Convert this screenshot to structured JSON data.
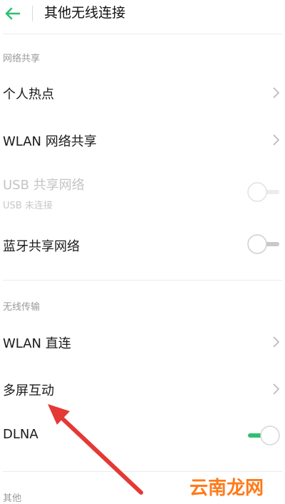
{
  "header": {
    "title": "其他无线连接",
    "back_icon": "arrow-left-icon",
    "accent": "#2fbf71"
  },
  "sections": {
    "network_sharing": {
      "title": "网络共享",
      "hotspot_label": "个人热点",
      "wlan_sharing_label": "WLAN 网络共享",
      "usb_sharing_label": "USB 共享网络",
      "usb_sharing_sub": "USB 未连接",
      "bluetooth_sharing_label": "蓝牙共享网络"
    },
    "wireless_transfer": {
      "title": "无线传输",
      "wlan_direct_label": "WLAN 直连",
      "multiscreen_label": "多屏互动",
      "dlna_label": "DLNA"
    },
    "other": {
      "title": "其他"
    }
  },
  "toggles": {
    "usb_sharing_on": false,
    "bluetooth_sharing_on": false,
    "dlna_on": true
  },
  "watermark": "云南龙网",
  "annotation": {
    "color": "#e53935"
  }
}
